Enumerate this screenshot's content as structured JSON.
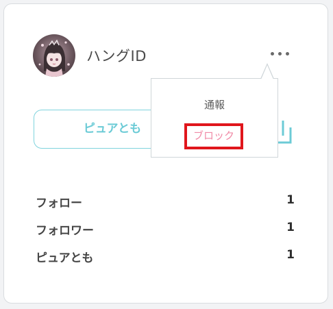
{
  "profile": {
    "username": "ハングID",
    "avatar_icon": "avatar-anime-girl-icon"
  },
  "actions": {
    "more_icon": "more-dots-icon",
    "primary_button_label": "ピュアとも",
    "share_icon": "share-icon"
  },
  "menu": {
    "items": [
      {
        "label": "通報"
      },
      {
        "label": "ブロック"
      }
    ],
    "highlight_color": "#e0161c"
  },
  "stats": [
    {
      "label": "フォロー",
      "value": "1"
    },
    {
      "label": "フォロワー",
      "value": "1"
    },
    {
      "label": "ピュアとも",
      "value": "1"
    }
  ],
  "colors": {
    "accent": "#7fd3dd",
    "block_text": "#f08aa6"
  }
}
